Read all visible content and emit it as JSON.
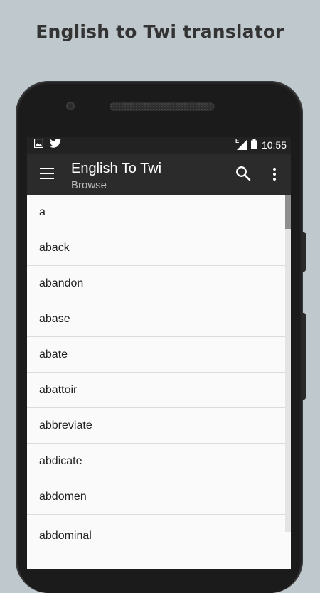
{
  "promo": {
    "title": "English to Twi translator"
  },
  "status_bar": {
    "time": "10:55",
    "network_type": "E",
    "icons": [
      "image-icon",
      "twitter-icon",
      "signal-icon",
      "battery-icon"
    ]
  },
  "app_bar": {
    "title": "English To Twi",
    "subtitle": "Browse",
    "menu_icon": "menu-icon",
    "search_icon": "search-icon",
    "overflow_icon": "more-vert-icon"
  },
  "words": [
    "a",
    "aback",
    "abandon",
    "abase",
    "abate",
    "abattoir",
    "abbreviate",
    "abdicate",
    "abdomen",
    "abdominal"
  ],
  "colors": {
    "app_bar": "#2b2b2b",
    "status_bar": "#222222",
    "background": "#bfc8cd",
    "list_bg": "#fafafa"
  }
}
